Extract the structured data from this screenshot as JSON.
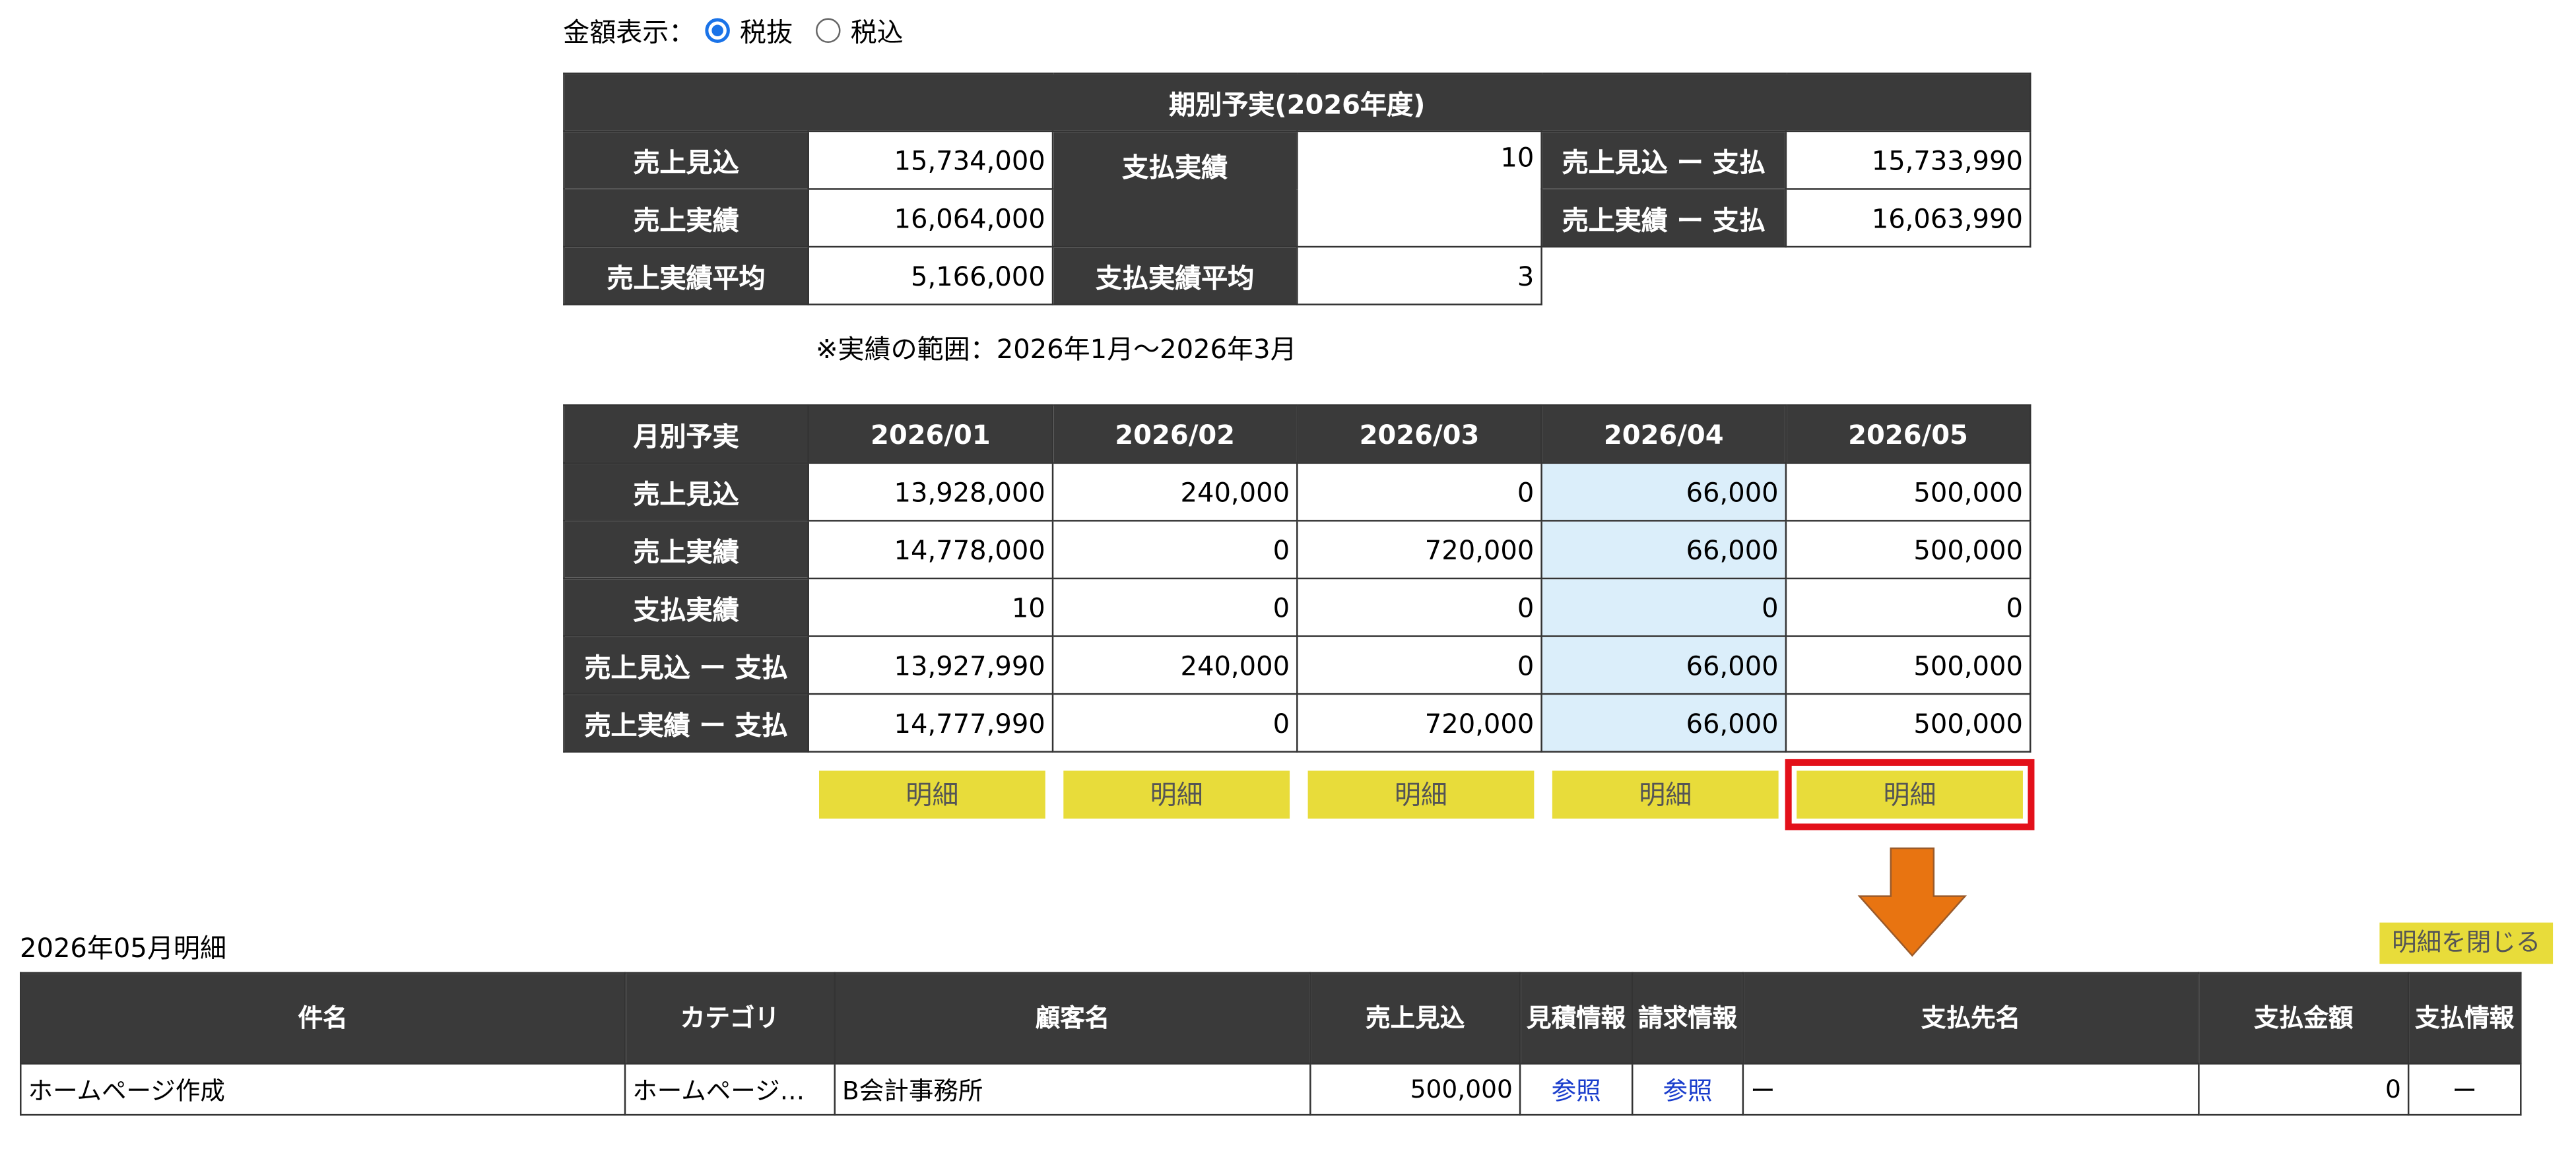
{
  "display_mode": {
    "label": "金額表示：",
    "options": [
      {
        "label": "税抜",
        "selected": true
      },
      {
        "label": "税込",
        "selected": false
      }
    ]
  },
  "period_summary": {
    "title": "期別予実(2026年度)",
    "rows": [
      {
        "k1": "売上見込",
        "v1": "15,734,000",
        "k2": "支払実績",
        "v2": "10",
        "k3": "売上見込 ー 支払",
        "v3": "15,733,990"
      },
      {
        "k1": "売上実績",
        "v1": "16,064,000",
        "k3": "売上実績 ー 支払",
        "v3": "16,063,990"
      },
      {
        "k1": "売上実績平均",
        "v1": "5,166,000",
        "k2": "支払実績平均",
        "v2": "3"
      }
    ],
    "note": "※実績の範囲：2026年1月〜2026年3月"
  },
  "monthly": {
    "corner": "月別予実",
    "months": [
      "2026/01",
      "2026/02",
      "2026/03",
      "2026/04",
      "2026/05"
    ],
    "rows": [
      {
        "label": "売上見込",
        "values": [
          "13,928,000",
          "240,000",
          "0",
          "66,000",
          "500,000"
        ]
      },
      {
        "label": "売上実績",
        "values": [
          "14,778,000",
          "0",
          "720,000",
          "66,000",
          "500,000"
        ]
      },
      {
        "label": "支払実績",
        "values": [
          "10",
          "0",
          "0",
          "0",
          "0"
        ]
      },
      {
        "label": "売上見込 ー 支払",
        "values": [
          "13,927,990",
          "240,000",
          "0",
          "66,000",
          "500,000"
        ]
      },
      {
        "label": "売上実績 ー 支払",
        "values": [
          "14,777,990",
          "0",
          "720,000",
          "66,000",
          "500,000"
        ]
      }
    ],
    "detail_button": "明細",
    "selected_month": "2026/05",
    "highlight_month": "2026/04"
  },
  "detail": {
    "title": "2026年05月明細",
    "close_label": "明細を閉じる",
    "headers": [
      "件名",
      "カテゴリ",
      "顧客名",
      "売上見込",
      "見積情報",
      "請求情報",
      "支払先名",
      "支払金額",
      "支払情報"
    ],
    "rows": [
      {
        "subject": "ホームページ作成",
        "category": "ホームページ…",
        "customer": "B会計事務所",
        "forecast": "500,000",
        "quote": "参照",
        "invoice": "参照",
        "payee": "ー",
        "payment": "0",
        "payinfo": "ー"
      }
    ]
  },
  "colors": {
    "header": "#3a3a3a",
    "button": "#e8dc3a",
    "highlight": "#dbeefa",
    "selected_outline": "#e3101a",
    "arrow": "#e87411",
    "link": "#1a3dcc"
  }
}
